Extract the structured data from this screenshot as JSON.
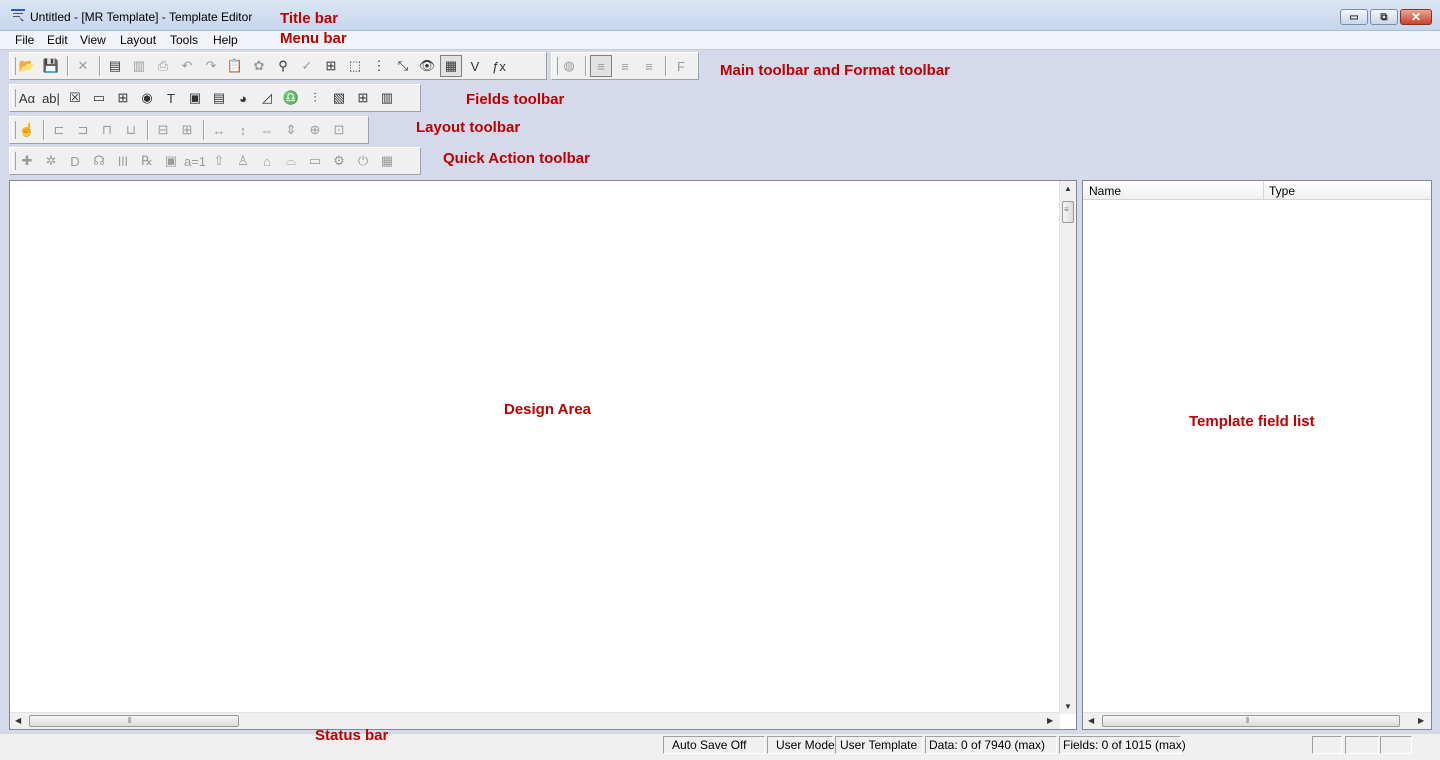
{
  "window": {
    "title": "Untitled - [MR Template] - Template Editor",
    "controls": {
      "minimize": "▭",
      "restore": "⧉",
      "close": "✕"
    }
  },
  "menu": [
    "File",
    "Edit",
    "View",
    "Layout",
    "Tools",
    "Help"
  ],
  "toolbars": {
    "main": [
      {
        "icon": "open-folder-icon",
        "glyph": "📂",
        "disabled": false
      },
      {
        "icon": "save-icon",
        "glyph": "💾",
        "disabled": true
      },
      {
        "sep": true
      },
      {
        "icon": "close-x-icon",
        "glyph": "✕",
        "disabled": true
      },
      {
        "sep": true
      },
      {
        "icon": "template-properties-icon",
        "glyph": "▤",
        "disabled": false
      },
      {
        "icon": "save-all-icon",
        "glyph": "▥",
        "disabled": true
      },
      {
        "icon": "print-icon",
        "glyph": "⎙",
        "disabled": true
      },
      {
        "icon": "undo-icon",
        "glyph": "↶",
        "disabled": true
      },
      {
        "icon": "redo-icon",
        "glyph": "↷",
        "disabled": true
      },
      {
        "icon": "clipboard-icon",
        "glyph": "📋",
        "disabled": false
      },
      {
        "icon": "brain-icon",
        "glyph": "✿",
        "disabled": true
      },
      {
        "icon": "binoculars-icon",
        "glyph": "⚲",
        "disabled": false
      },
      {
        "icon": "check-icon",
        "glyph": "✓",
        "disabled": true
      },
      {
        "icon": "tab-order-icon",
        "glyph": "⊞",
        "disabled": false
      },
      {
        "icon": "select-box-icon",
        "glyph": "⬚",
        "disabled": false
      },
      {
        "icon": "grid-icon",
        "glyph": "⋮",
        "disabled": false
      },
      {
        "icon": "snap-icon",
        "glyph": "⤡",
        "disabled": false
      },
      {
        "icon": "preview-eye-icon",
        "glyph": "👁",
        "disabled": false
      },
      {
        "icon": "field-list-icon",
        "glyph": "▦",
        "disabled": false,
        "pressed": true
      },
      {
        "icon": "variable-v-icon",
        "glyph": "V",
        "disabled": false
      },
      {
        "icon": "function-fx-icon",
        "glyph": "ƒx",
        "disabled": false
      }
    ],
    "format": [
      {
        "icon": "color-icon",
        "glyph": "◍",
        "disabled": true
      },
      {
        "sep": true
      },
      {
        "icon": "align-left-icon",
        "glyph": "≡",
        "disabled": true,
        "pressed": true
      },
      {
        "icon": "align-center-icon",
        "glyph": "≡",
        "disabled": true
      },
      {
        "icon": "align-right-icon",
        "glyph": "≡",
        "disabled": true
      },
      {
        "sep": true
      },
      {
        "icon": "font-icon",
        "glyph": "F",
        "disabled": true
      }
    ],
    "fields": [
      {
        "icon": "label-text-icon",
        "glyph": "Aα",
        "disabled": false
      },
      {
        "icon": "textbox-icon",
        "glyph": "ab|",
        "disabled": false
      },
      {
        "icon": "checkbox-icon",
        "glyph": "☒",
        "disabled": false
      },
      {
        "icon": "button-icon",
        "glyph": "▭",
        "disabled": false
      },
      {
        "icon": "table-icon",
        "glyph": "⊞",
        "disabled": false
      },
      {
        "icon": "radio-icon",
        "glyph": "◉",
        "disabled": false
      },
      {
        "icon": "static-text-icon",
        "glyph": "T",
        "disabled": false
      },
      {
        "icon": "image-field-icon",
        "glyph": "▣",
        "disabled": false
      },
      {
        "icon": "memo-icon",
        "glyph": "▤",
        "disabled": false
      },
      {
        "icon": "globe-icon",
        "glyph": "◕",
        "disabled": false
      },
      {
        "icon": "chart-icon",
        "glyph": "◿",
        "disabled": false
      },
      {
        "icon": "body-figure-icon",
        "glyph": "♎",
        "disabled": false
      },
      {
        "icon": "bar-scale-icon",
        "glyph": "⫶",
        "disabled": false
      },
      {
        "icon": "panel-icon",
        "glyph": "▧",
        "disabled": false
      },
      {
        "icon": "grid-table-icon",
        "glyph": "⊞",
        "disabled": false
      },
      {
        "icon": "database-icon",
        "glyph": "▥",
        "disabled": false
      }
    ],
    "layout": [
      {
        "icon": "pointer-icon",
        "glyph": "☝",
        "disabled": true
      },
      {
        "sep": true
      },
      {
        "icon": "align-lefts-icon",
        "glyph": "⊏",
        "disabled": true
      },
      {
        "icon": "align-rights-icon",
        "glyph": "⊐",
        "disabled": true
      },
      {
        "icon": "align-tops-icon",
        "glyph": "⊓",
        "disabled": true
      },
      {
        "icon": "align-bottoms-icon",
        "glyph": "⊔",
        "disabled": true
      },
      {
        "sep": true
      },
      {
        "icon": "center-vertical-icon",
        "glyph": "⊟",
        "disabled": true
      },
      {
        "icon": "center-horizontal-icon",
        "glyph": "⊞",
        "disabled": true
      },
      {
        "sep": true
      },
      {
        "icon": "space-horizontal-icon",
        "glyph": "↔",
        "disabled": true
      },
      {
        "icon": "space-vertical-icon",
        "glyph": "↕",
        "disabled": true
      },
      {
        "icon": "same-width-icon",
        "glyph": "⇔",
        "disabled": true
      },
      {
        "icon": "same-height-icon",
        "glyph": "⇕",
        "disabled": true
      },
      {
        "icon": "same-size-icon",
        "glyph": "⊕",
        "disabled": true
      },
      {
        "icon": "size-to-fit-icon",
        "glyph": "⊡",
        "disabled": true
      }
    ],
    "quick": [
      {
        "icon": "add-field-icon",
        "glyph": "✚",
        "disabled": true
      },
      {
        "icon": "gears-icon",
        "glyph": "✲",
        "disabled": true
      },
      {
        "icon": "diagnosis-icon",
        "glyph": "D",
        "disabled": true
      },
      {
        "icon": "stethoscope-icon",
        "glyph": "☊",
        "disabled": true
      },
      {
        "icon": "vitals-icon",
        "glyph": "ǀǀǀ",
        "disabled": true
      },
      {
        "icon": "prescription-icon",
        "glyph": "℞",
        "disabled": true
      },
      {
        "icon": "document-icon",
        "glyph": "▣",
        "disabled": true
      },
      {
        "icon": "equals-icon",
        "glyph": "a=1",
        "disabled": true
      },
      {
        "icon": "upload-icon",
        "glyph": "⇧",
        "disabled": true
      },
      {
        "icon": "person-icon",
        "glyph": "♙",
        "disabled": true
      },
      {
        "icon": "bed-icon",
        "glyph": "⌂",
        "disabled": true
      },
      {
        "icon": "hat-icon",
        "glyph": "⌓",
        "disabled": true
      },
      {
        "icon": "box-icon",
        "glyph": "▭",
        "disabled": true
      },
      {
        "icon": "settings-icon",
        "glyph": "⚙",
        "disabled": true
      },
      {
        "icon": "power-icon",
        "glyph": "⏻",
        "disabled": true
      },
      {
        "icon": "barcode-icon",
        "glyph": "▦",
        "disabled": true
      }
    ]
  },
  "annotations": {
    "title_bar": "Title bar",
    "menu_bar": "Menu bar",
    "main_format": "Main toolbar and Format toolbar",
    "fields": "Fields toolbar",
    "layout": "Layout toolbar",
    "quick": "Quick Action toolbar",
    "design_area": "Design Area",
    "field_list": "Template field list",
    "status_bar": "Status bar"
  },
  "field_list": {
    "columns": [
      "Name",
      "Type"
    ],
    "rows": []
  },
  "scroll": {
    "up": "▲",
    "down": "▼",
    "left": "◀",
    "right": "▶",
    "grip_v": "≡",
    "grip_h": "⦀"
  },
  "status": {
    "auto_save": "Auto Save Off",
    "mode": "User Mode",
    "template": "User Template",
    "data": "Data: 0 of 7940 (max)",
    "fields": "Fields: 0 of 1015 (max)"
  }
}
